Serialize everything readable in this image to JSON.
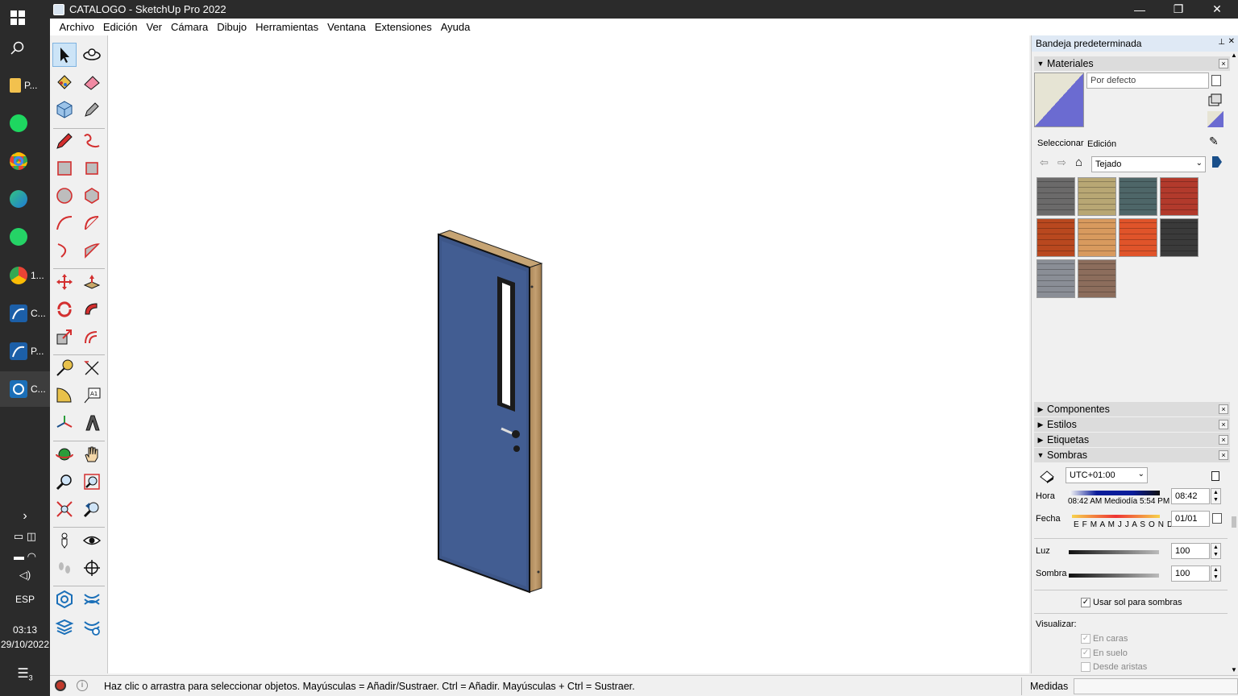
{
  "window": {
    "title": "CATALOGO - SketchUp Pro 2022",
    "controls": {
      "minimize": "—",
      "restore": "❐",
      "close": "✕"
    }
  },
  "menu": [
    "Archivo",
    "Edición",
    "Ver",
    "Cámara",
    "Dibujo",
    "Herramientas",
    "Ventana",
    "Extensiones",
    "Ayuda"
  ],
  "taskbar": {
    "apps": [
      {
        "name": "file-explorer",
        "label": "P..."
      },
      {
        "name": "spotify",
        "label": ""
      },
      {
        "name": "chrome",
        "label": ""
      },
      {
        "name": "edge",
        "label": ""
      },
      {
        "name": "whatsapp",
        "label": ""
      },
      {
        "name": "chrome-profile",
        "label": "1..."
      },
      {
        "name": "app-c",
        "label": "C..."
      },
      {
        "name": "app-p",
        "label": "P..."
      },
      {
        "name": "sketchup",
        "label": "C..."
      }
    ],
    "language": "ESP",
    "time": "03:13",
    "date": "29/10/2022",
    "notifications": "3"
  },
  "tray": {
    "title": "Bandeja predeterminada",
    "materials": {
      "header": "Materiales",
      "current_name": "Por defecto",
      "tabs": [
        "Seleccionar",
        "Edición"
      ],
      "library": "Tejado",
      "swatch_colors": [
        "#6b6a6a",
        "#b8a774",
        "#4e6668",
        "#b23a2c",
        "#b9481f",
        "#d89a5e",
        "#e0542a",
        "#3a3a3a",
        "#8a8e96",
        "#8c6d5c"
      ]
    },
    "collapsed_sections": [
      "Componentes",
      "Estilos",
      "Etiquetas"
    ],
    "shadows": {
      "header": "Sombras",
      "timezone": "UTC+01:00",
      "time_label": "Hora",
      "time_scale": "08:42 AM Mediodía 5:54 PM",
      "time_value": "08:42",
      "date_label": "Fecha",
      "date_scale": "E F M A M J J A S O N D",
      "date_value": "01/01",
      "light_label": "Luz",
      "light_value": "100",
      "shadow_label": "Sombra",
      "shadow_value": "100",
      "use_sun_label": "Usar sol para sombras",
      "display_label": "Visualizar:",
      "on_faces": "En caras",
      "on_ground": "En suelo",
      "from_edges": "Desde aristas"
    }
  },
  "status": {
    "message": "Haz clic o arrastra para seleccionar objetos. Mayúsculas = Añadir/Sustraer. Ctrl = Añadir. Mayúsculas + Ctrl = Sustraer.",
    "measurements_label": "Medidas"
  }
}
